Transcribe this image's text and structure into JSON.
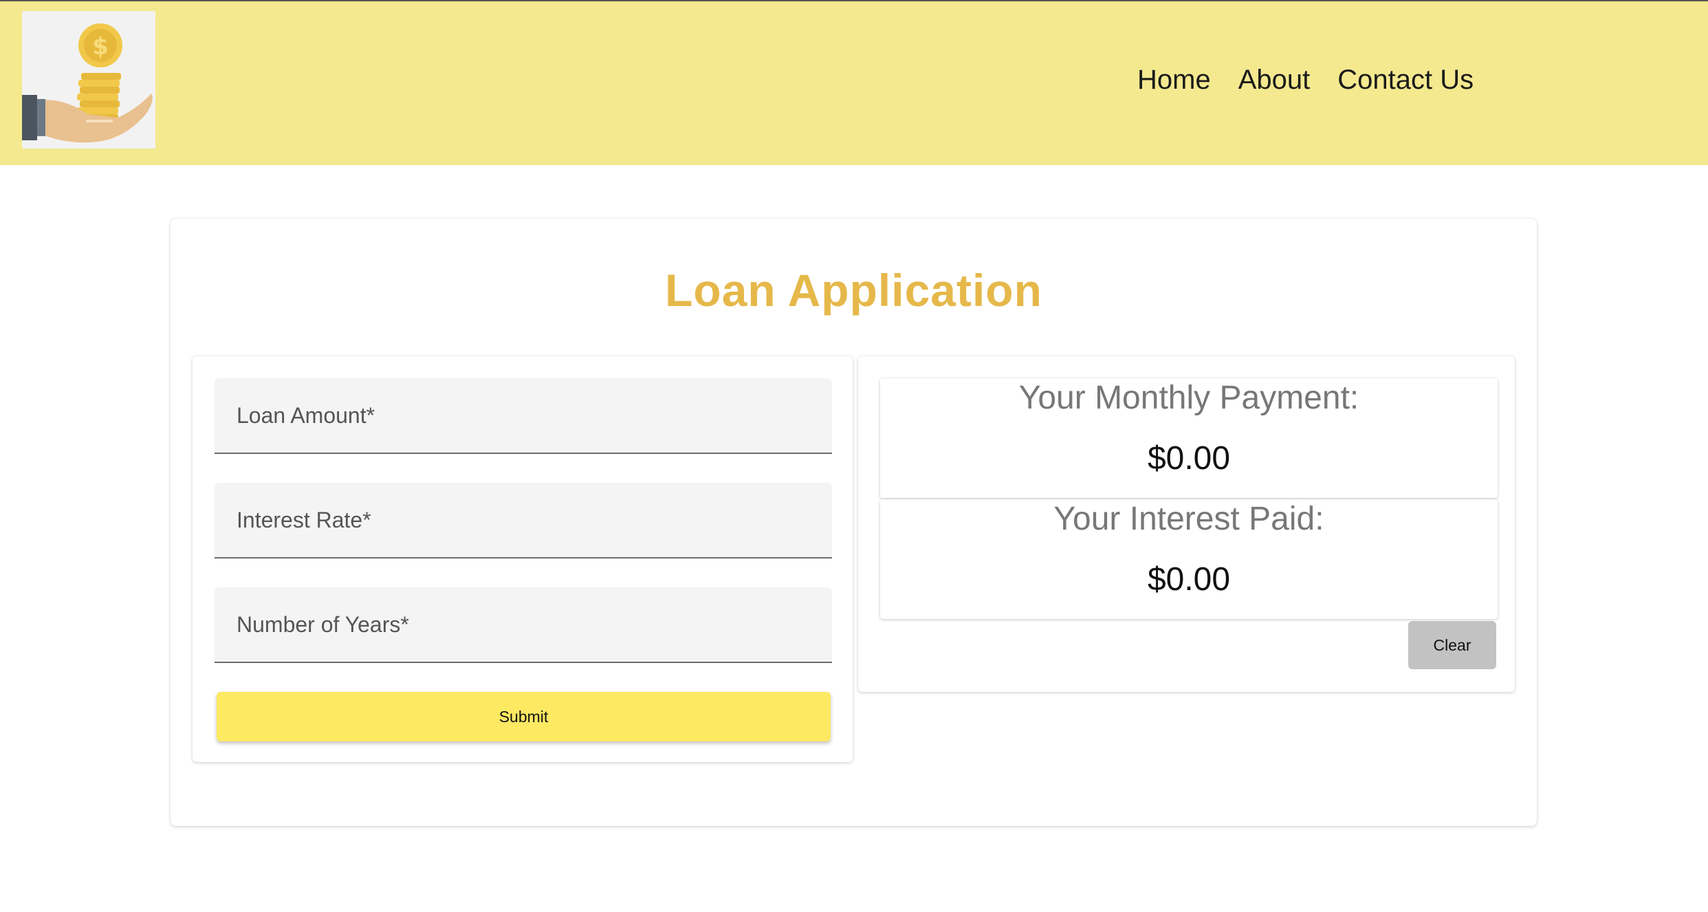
{
  "header": {
    "logo_icon": "coins-in-hand-icon",
    "nav": [
      "Home",
      "About",
      "Contact Us"
    ]
  },
  "main": {
    "title": "Loan Application",
    "form": {
      "fields": [
        {
          "label": "Loan Amount*",
          "value": ""
        },
        {
          "label": "Interest Rate*",
          "value": ""
        },
        {
          "label": "Number of Years*",
          "value": ""
        }
      ],
      "submit_label": "Submit"
    },
    "results": {
      "monthly_payment_label": "Your Monthly Payment:",
      "monthly_payment_value": "$0.00",
      "interest_paid_label": "Your Interest Paid:",
      "interest_paid_value": "$0.00",
      "clear_label": "Clear"
    }
  },
  "colors": {
    "header_bg": "#f4e98f",
    "title": "#e6b84a",
    "submit_bg": "#fde962",
    "clear_bg": "#c2c2c2"
  }
}
